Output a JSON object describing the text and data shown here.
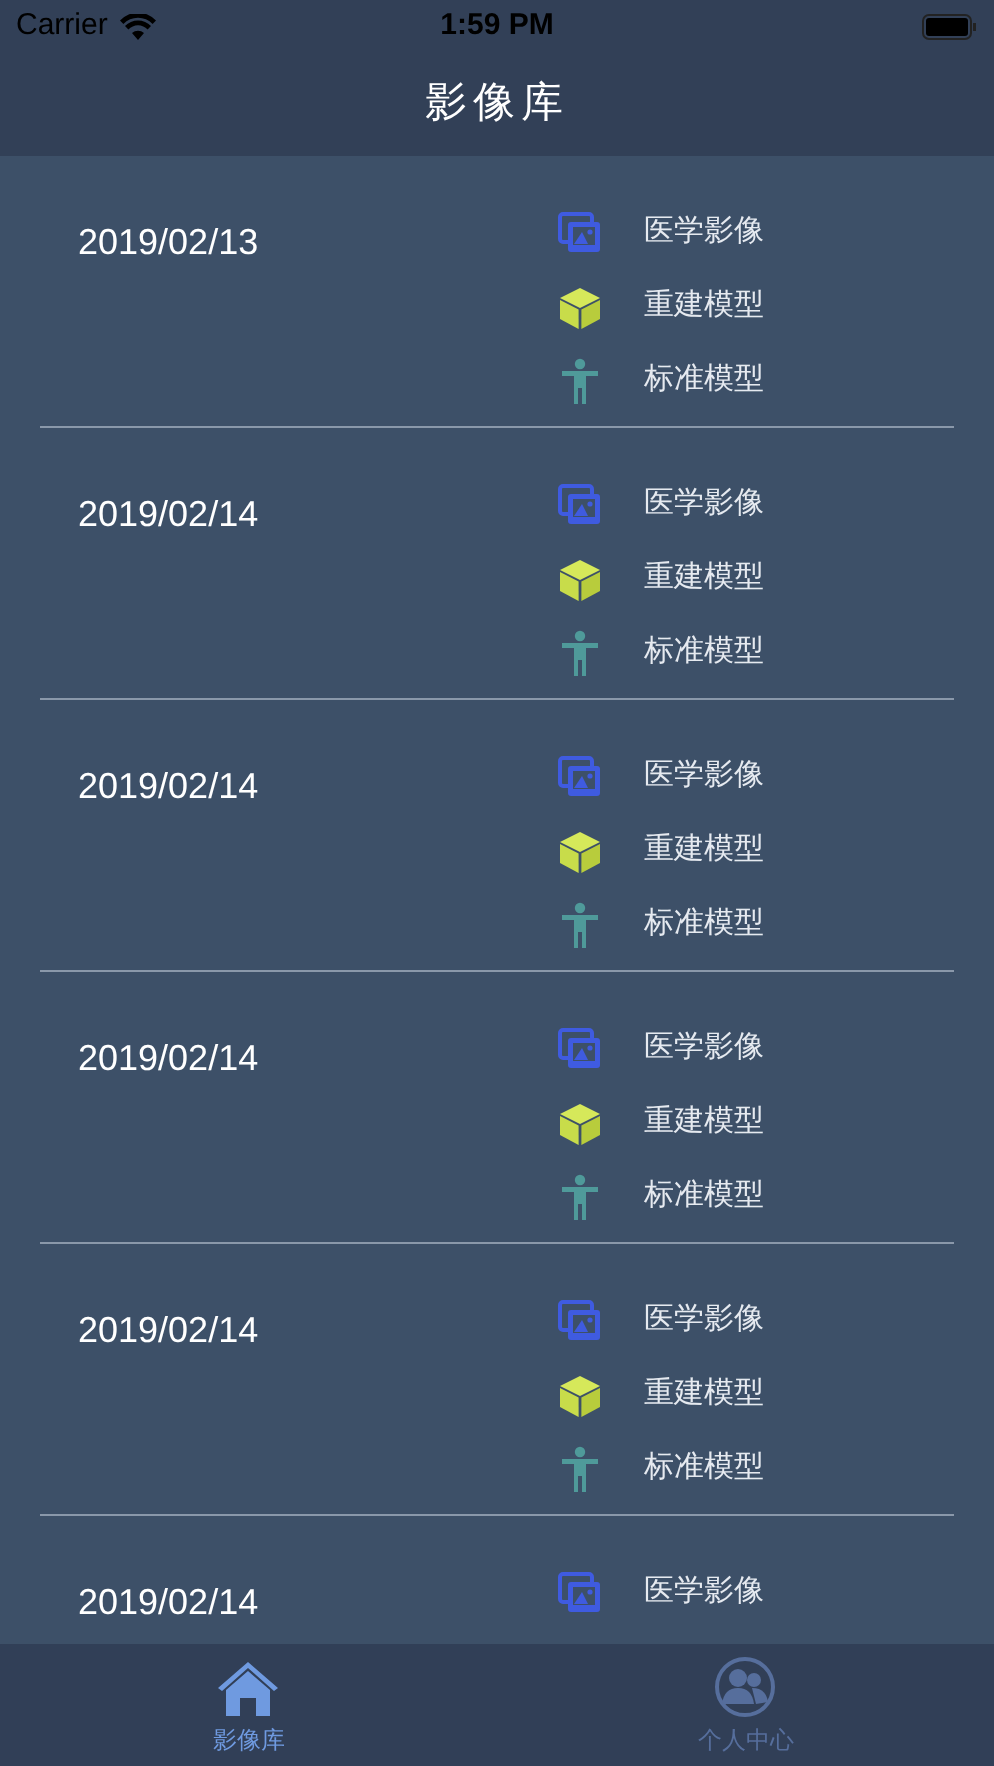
{
  "status_bar": {
    "carrier": "Carrier",
    "time": "1:59 PM"
  },
  "title": "影像库",
  "records": [
    {
      "date": "2019/02/13",
      "items": [
        {
          "kind": "image",
          "label": "医学影像"
        },
        {
          "kind": "model",
          "label": "重建模型"
        },
        {
          "kind": "standard",
          "label": "标准模型"
        }
      ]
    },
    {
      "date": "2019/02/14",
      "items": [
        {
          "kind": "image",
          "label": "医学影像"
        },
        {
          "kind": "model",
          "label": "重建模型"
        },
        {
          "kind": "standard",
          "label": "标准模型"
        }
      ]
    },
    {
      "date": "2019/02/14",
      "items": [
        {
          "kind": "image",
          "label": "医学影像"
        },
        {
          "kind": "model",
          "label": "重建模型"
        },
        {
          "kind": "standard",
          "label": "标准模型"
        }
      ]
    },
    {
      "date": "2019/02/14",
      "items": [
        {
          "kind": "image",
          "label": "医学影像"
        },
        {
          "kind": "model",
          "label": "重建模型"
        },
        {
          "kind": "standard",
          "label": "标准模型"
        }
      ]
    },
    {
      "date": "2019/02/14",
      "items": [
        {
          "kind": "image",
          "label": "医学影像"
        },
        {
          "kind": "model",
          "label": "重建模型"
        },
        {
          "kind": "standard",
          "label": "标准模型"
        }
      ]
    },
    {
      "date": "2019/02/14",
      "items": [
        {
          "kind": "image",
          "label": "医学影像"
        }
      ]
    }
  ],
  "tabs": [
    {
      "kind": "home",
      "label": "影像库",
      "selected": true
    },
    {
      "kind": "people",
      "label": "个人中心",
      "selected": false
    }
  ]
}
